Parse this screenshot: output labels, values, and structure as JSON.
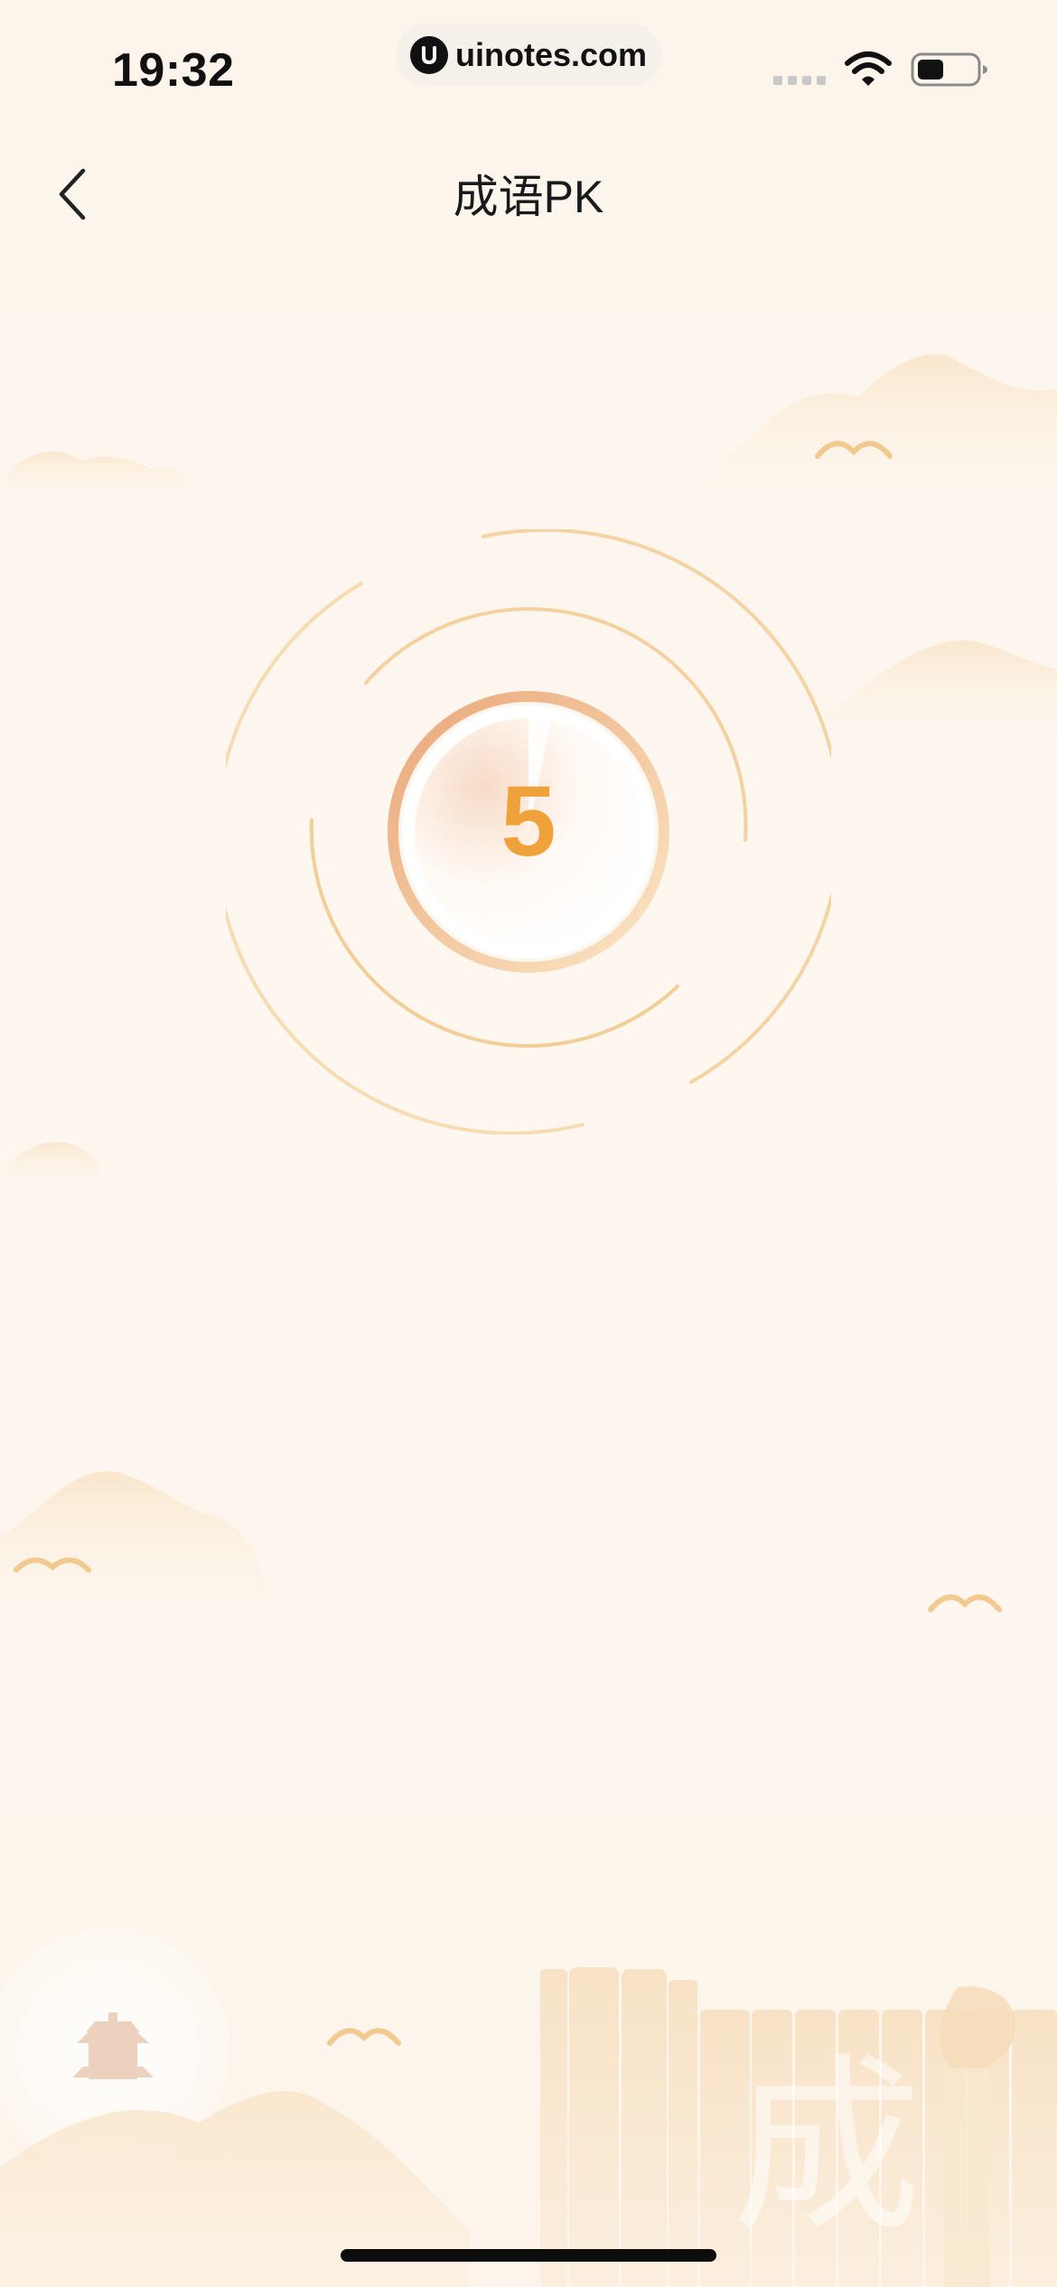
{
  "status_bar": {
    "time": "19:32",
    "url": "uinotes.com",
    "icons": [
      "signal-icon",
      "wifi-icon",
      "battery-icon"
    ]
  },
  "nav": {
    "back_icon": "chevron-left-icon",
    "title": "成语PK"
  },
  "countdown": {
    "value": "5",
    "number_color": "#f0a23a"
  },
  "decoration": {
    "banner_text": "成语",
    "icons": [
      "cloud-mountain-icon",
      "bird-icon",
      "pagoda-icon",
      "book-icon",
      "brush-icon"
    ]
  },
  "colors": {
    "background": "#fdf6ee",
    "accent": "#f0a23a",
    "ring": "#f3cf98",
    "decor": "#f7e3c4"
  }
}
